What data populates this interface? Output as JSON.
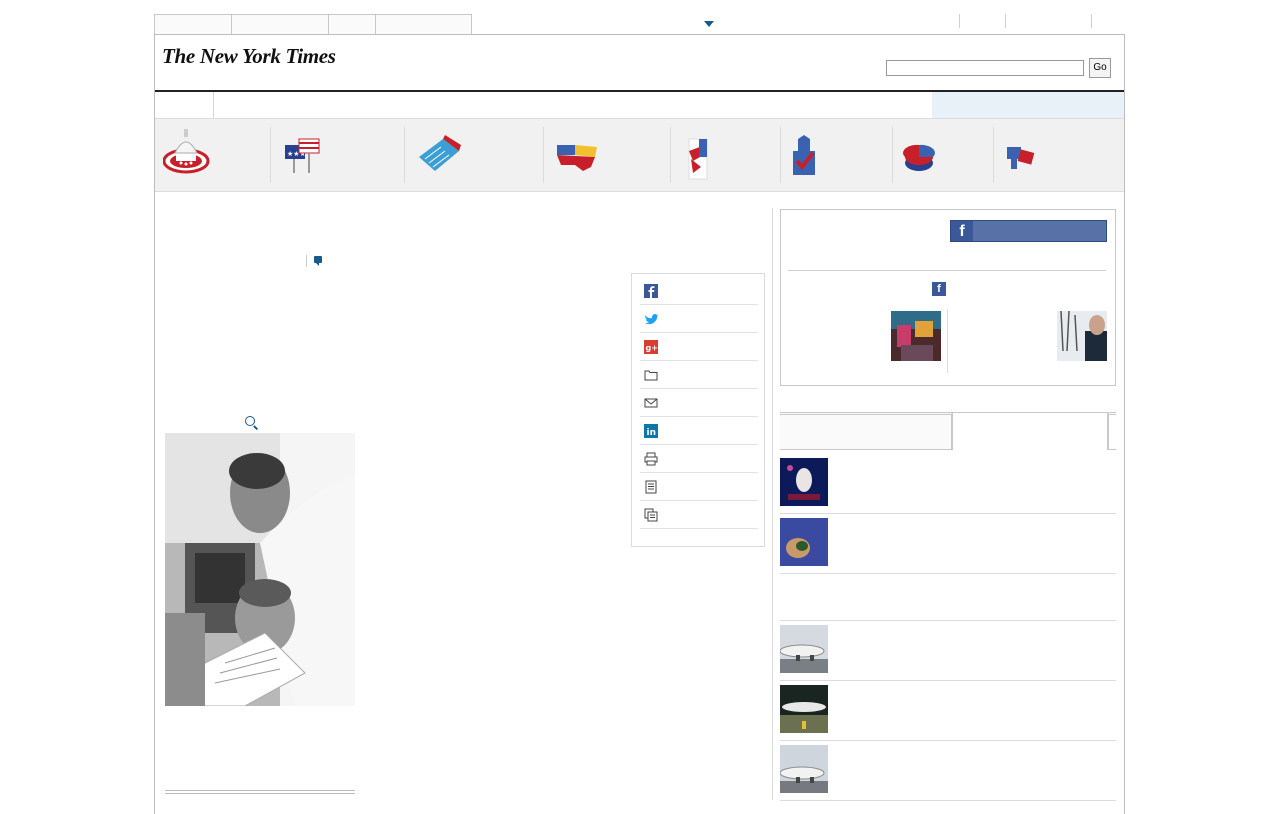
{
  "header": {
    "logo_text": "The New York Times",
    "search_placeholder": "",
    "go_label": "Go"
  },
  "share": {
    "items": [
      {
        "icon": "facebook-icon",
        "color": "#3b5998"
      },
      {
        "icon": "twitter-icon",
        "color": "#1da1f2"
      },
      {
        "icon": "google-plus-icon",
        "color": "#d73d32"
      },
      {
        "icon": "folder-icon",
        "color": "#444444"
      },
      {
        "icon": "email-icon",
        "color": "#444444"
      },
      {
        "icon": "linkedin-icon",
        "color": "#0e76a8"
      },
      {
        "icon": "print-icon",
        "color": "#444444"
      },
      {
        "icon": "single-page-icon",
        "color": "#444444"
      },
      {
        "icon": "reprints-icon",
        "color": "#444444"
      }
    ]
  },
  "facebook": {
    "brand_color": "#3b5998",
    "f_glyph": "f"
  },
  "colors": {
    "link_blue": "#1a5a8a",
    "nav_tint": "#e9f1f8",
    "band_gray": "#f1f1f1"
  }
}
